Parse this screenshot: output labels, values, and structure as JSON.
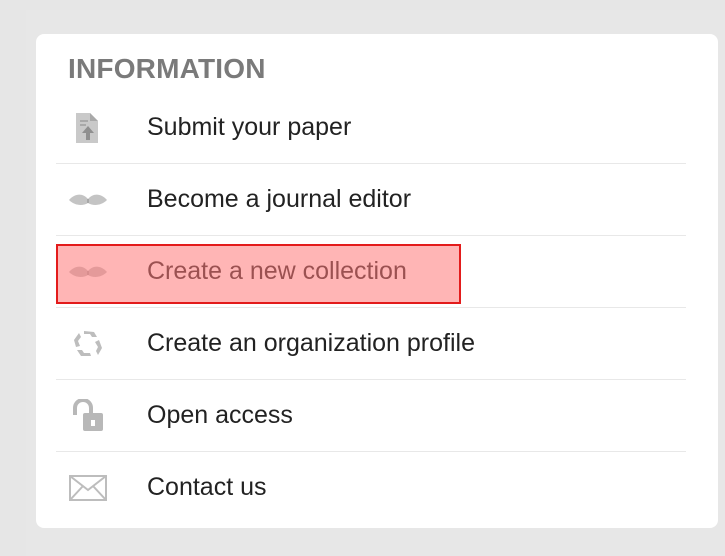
{
  "info_panel": {
    "title": "INFORMATION",
    "items": [
      {
        "label": "Submit your paper",
        "icon": "document-upload-icon"
      },
      {
        "label": "Become a journal editor",
        "icon": "open-book-icon"
      },
      {
        "label": "Create a new collection",
        "icon": "open-book-icon",
        "highlighted": true
      },
      {
        "label": "Create an organization profile",
        "icon": "recycle-arrows-icon"
      },
      {
        "label": "Open access",
        "icon": "open-padlock-icon"
      },
      {
        "label": "Contact us",
        "icon": "envelope-icon"
      }
    ]
  },
  "colors": {
    "background": "#e6e6e6",
    "card": "#ffffff",
    "title": "#7a7a7a",
    "text": "#222222",
    "icon": "#b5b5b5",
    "highlight_border": "#e31b1b",
    "highlight_fill": "#ff7878"
  }
}
